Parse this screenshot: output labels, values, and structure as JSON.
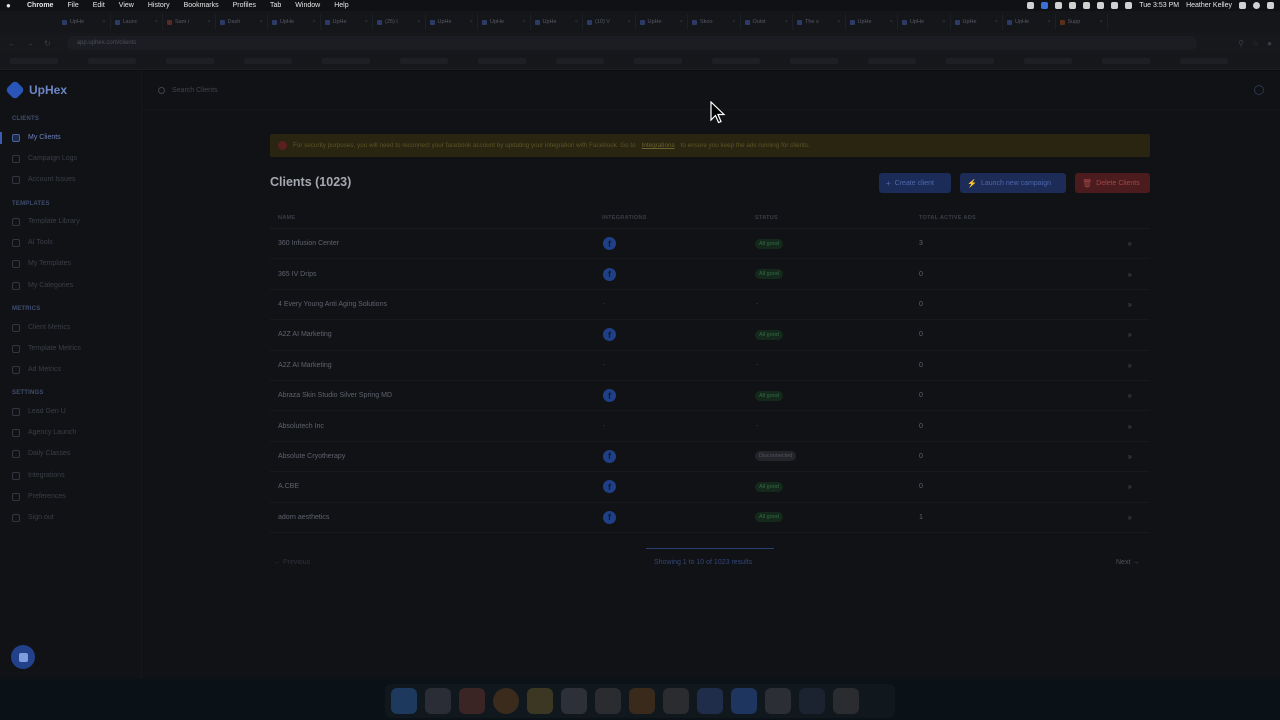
{
  "menubar": {
    "app": "Chrome",
    "items": [
      "File",
      "Edit",
      "View",
      "History",
      "Bookmarks",
      "Profiles",
      "Tab",
      "Window",
      "Help"
    ],
    "clock": "Tue 3:53 PM",
    "user": "Heather Kelley"
  },
  "browser": {
    "tabs": [
      "UpHe",
      "Launc",
      "Sam i",
      "Dash",
      "UpHe",
      "UpHe",
      "(25) I",
      "UpHe",
      "UpHe",
      "UpHe",
      "(10) V",
      "UpHe",
      "Skoo",
      "Outst",
      "The s",
      "UpHe",
      "UpHe",
      "UpHe",
      "UpHe",
      "Supp"
    ],
    "url": "app.uphex.com/clients"
  },
  "app": {
    "brand": "UpHex",
    "search_placeholder": "Search Clients"
  },
  "sidebar": {
    "sections": [
      {
        "title": "CLIENTS",
        "items": [
          "My Clients",
          "Campaign Logs",
          "Account Issues"
        ]
      },
      {
        "title": "TEMPLATES",
        "items": [
          "Template Library",
          "AI Tools",
          "My Templates",
          "My Categories"
        ]
      },
      {
        "title": "METRICS",
        "items": [
          "Client Metrics",
          "Template Metrics",
          "Ad Metrics"
        ]
      },
      {
        "title": "SETTINGS",
        "items": [
          "Lead Gen U",
          "Agency Launch",
          "Daily Classes",
          "Integrations",
          "Preferences",
          "Sign out"
        ]
      }
    ]
  },
  "banner": {
    "text": "For security purposes, you will need to reconnect your facebook account by updating your integration with Facebook. Go to ",
    "link": "Integrations",
    "tail": " to ensure you keep the ads running for clients."
  },
  "page": {
    "title": "Clients (1023)",
    "create_label": "Create client",
    "launch_label": "Launch new campaign",
    "delete_label": "Delete Clients"
  },
  "table": {
    "headers": [
      "NAME",
      "INTEGRATIONS",
      "STATUS",
      "TOTAL ACTIVE ADS"
    ],
    "rows": [
      {
        "name": "360 Infusion Center",
        "integration": "facebook",
        "status": "All good",
        "ads": "3"
      },
      {
        "name": "365 IV Drips",
        "integration": "facebook",
        "status": "All good",
        "ads": "0"
      },
      {
        "name": "4 Every Young Anti Aging Solutions",
        "integration": "-",
        "status": "-",
        "ads": "0"
      },
      {
        "name": "A2Z AI Marketing",
        "integration": "facebook",
        "status": "All good",
        "ads": "0"
      },
      {
        "name": "A2Z AI Marketing",
        "integration": "-",
        "status": "-",
        "ads": "0"
      },
      {
        "name": "Abraza Skin Studio Silver Spring MD",
        "integration": "facebook",
        "status": "All good",
        "ads": "0"
      },
      {
        "name": "Absolutech Inc",
        "integration": "-",
        "status": "-",
        "ads": "0"
      },
      {
        "name": "Absolute Cryotherapy",
        "integration": "facebook",
        "status": "Disconnected",
        "ads": "0"
      },
      {
        "name": "A.CBE",
        "integration": "facebook",
        "status": "All good",
        "ads": "0"
      },
      {
        "name": "adorn aesthetics",
        "integration": "facebook",
        "status": "All good",
        "ads": "1"
      }
    ]
  },
  "pagination": {
    "previous": "← Previous",
    "showing": "Showing 1 to 10 of 1023 results",
    "next": "Next →"
  },
  "colors": {
    "accent": "#2a55b8",
    "success": "#356b45",
    "danger": "#a14848"
  }
}
